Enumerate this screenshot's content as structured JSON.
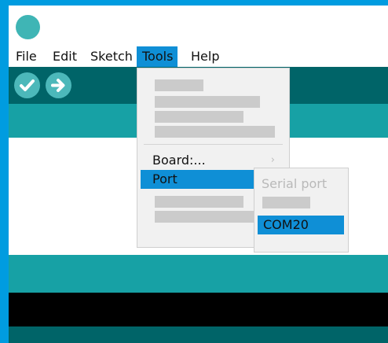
{
  "menubar": {
    "file": "File",
    "edit": "Edit",
    "sketch": "Sketch",
    "tools": "Tools",
    "help": "Help"
  },
  "toolbar": {
    "verify_icon": "checkmark-icon",
    "upload_icon": "arrow-right-icon"
  },
  "tools_menu": {
    "board_label": "Board:...",
    "port_label": "Port",
    "submenu_arrow": "›"
  },
  "port_submenu": {
    "header": "Serial port",
    "selected_port": "COM20"
  },
  "colors": {
    "accent_blue": "#0f8fd6",
    "frame_blue": "#009ce0",
    "toolbar_teal": "#006468",
    "tab_teal": "#17a1a5",
    "button_teal": "#4cb8ba"
  }
}
